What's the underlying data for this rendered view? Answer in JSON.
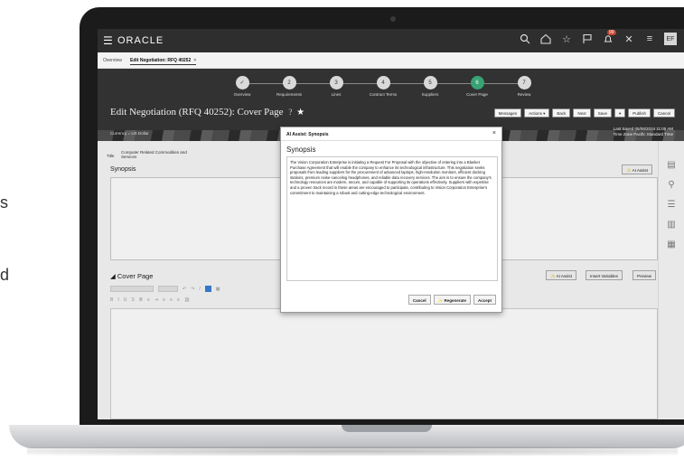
{
  "slide_fragments": {
    "frag1": "s",
    "frag2": "d"
  },
  "app": {
    "brand": "ORACLE",
    "notifications_count": "99",
    "avatar_initials": "EF"
  },
  "tabs": [
    {
      "label": "Overview"
    },
    {
      "label": "Edit Negotiation: RFQ 40252"
    }
  ],
  "stepper": [
    {
      "label": "Overview",
      "number": "✓"
    },
    {
      "label": "Requirements",
      "number": "2"
    },
    {
      "label": "Lines",
      "number": "3"
    },
    {
      "label": "Contract Terms",
      "number": "4"
    },
    {
      "label": "Suppliers",
      "number": "5"
    },
    {
      "label": "Cover Page",
      "number": "6"
    },
    {
      "label": "Review",
      "number": "7"
    }
  ],
  "header": {
    "title": "Edit Negotiation (RFQ 40252): Cover Page",
    "help": "?",
    "currency": "Currency = US Dollar",
    "last_saved": "Last Saved 05/08/2024 11:05 AM",
    "time_zone": "Time Zone Pacific Standard Time"
  },
  "actions": {
    "messages": "Messages",
    "actions": "Actions",
    "back": "Back",
    "next": "Next",
    "save": "Save",
    "publish": "Publish",
    "cancel": "Cancel"
  },
  "form": {
    "title_label": "Title",
    "title_value": "Computer Related Commodities and Services",
    "synopsis_label": "Synopsis",
    "ai_assist": "AI Assist",
    "cover_page_label": "Cover Page",
    "insert_variables": "Insert Variables",
    "preview": "Preview"
  },
  "modal": {
    "title": "AI Assist: Synopsis",
    "close": "×",
    "heading": "Synopsis",
    "body": "The Vision Corporation Enterprise is initiating a Request For Proposal with the objective of entering into a Blanket Purchase Agreement that will enable the company to enhance its technological infrastructure. This negotiation seeks proposals from leading suppliers for the procurement of advanced laptops, high-resolution monitors, efficient docking stations, premium noise-canceling headphones, and reliable data recovery services. The aim is to ensure the company's technology resources are modern, secure, and capable of supporting its operations effectively. Suppliers with expertise and a proven track record in these areas are encouraged to participate, contributing to Vision Corporation Enterprise's commitment to maintaining a robust and cutting-edge technological environment.",
    "cancel": "Cancel",
    "regenerate": "Regenerate",
    "accept": "Accept"
  }
}
